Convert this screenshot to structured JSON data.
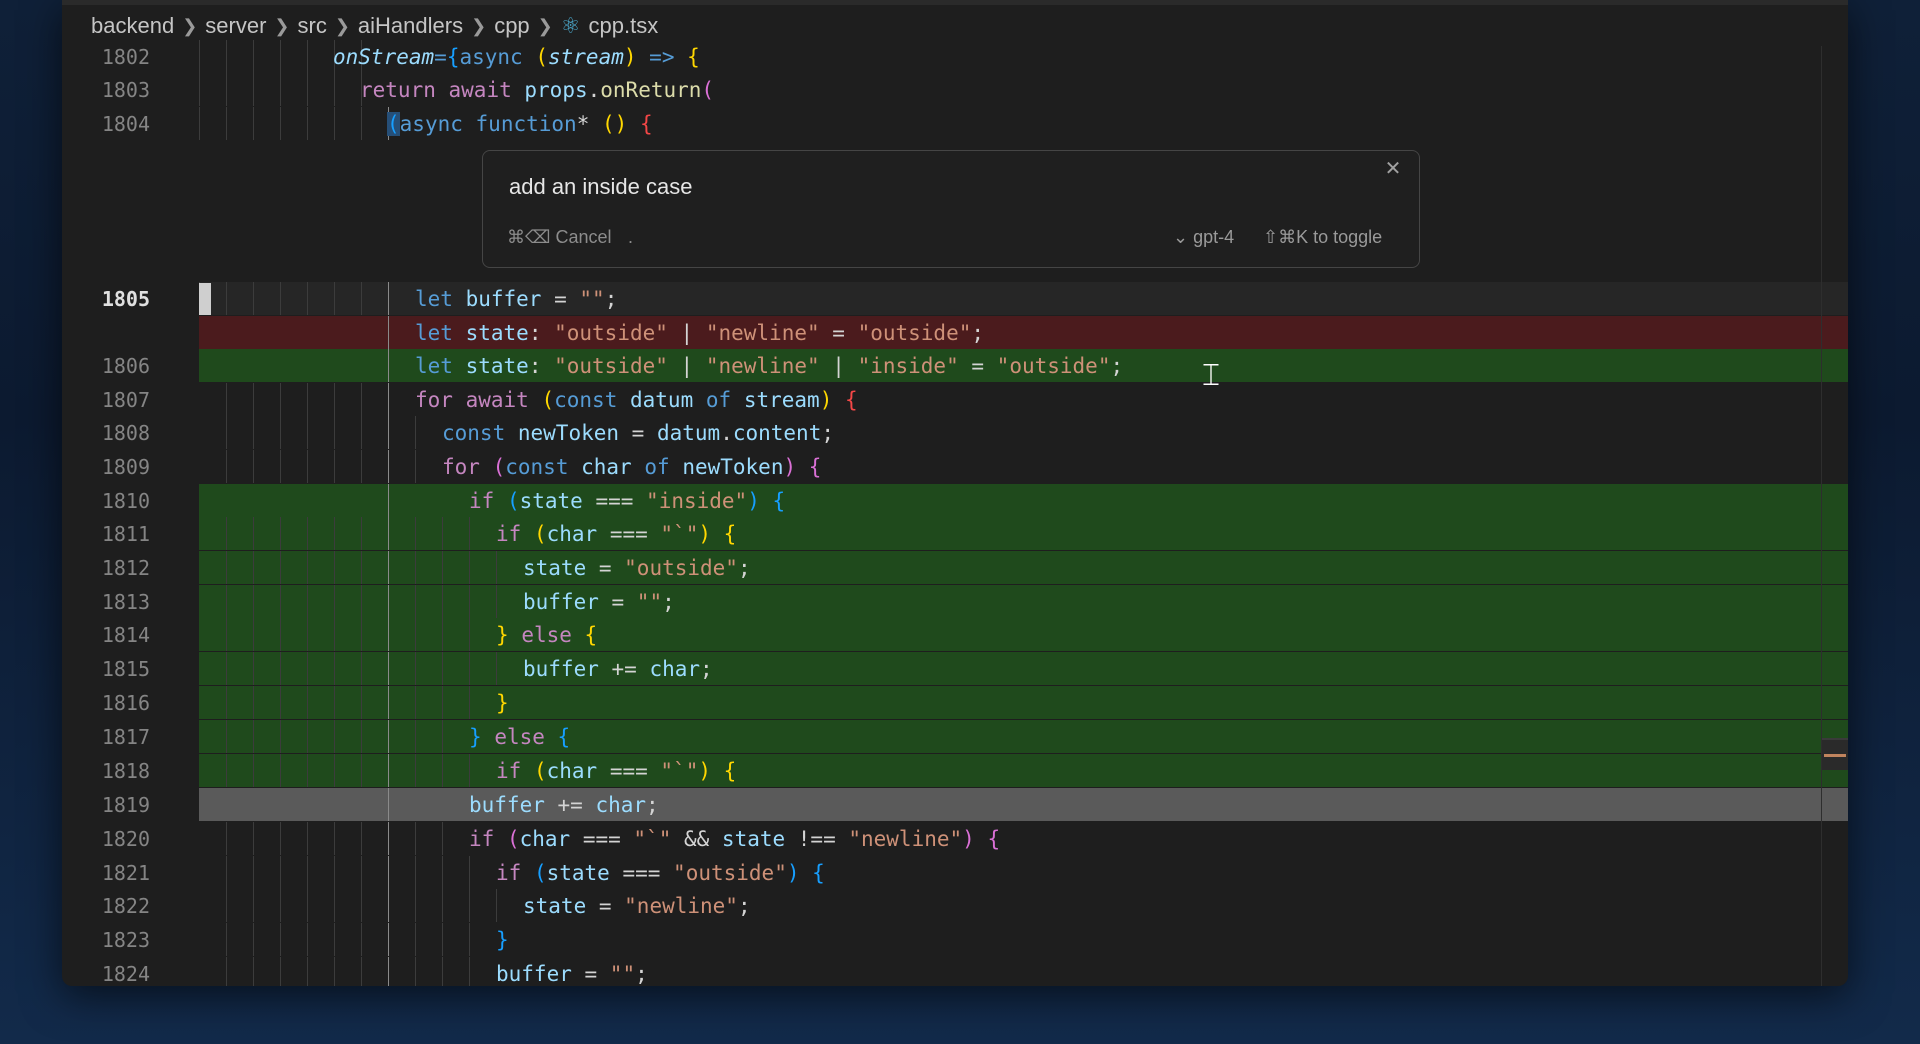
{
  "breadcrumb": [
    "backend",
    "server",
    "src",
    "aiHandlers",
    "cpp"
  ],
  "file": {
    "name": "cpp.tsx",
    "icon": "react-icon"
  },
  "prompt": {
    "value": "add an inside case",
    "cancel": "⌘⌫ Cancel",
    "dot": ".",
    "model": "⌄ gpt-4",
    "toggle": "⇧⌘K to toggle"
  },
  "code": [
    {
      "n": "1802",
      "t": "onStream={async (stream) => {"
    },
    {
      "n": "1803",
      "t": "return await props.onReturn("
    },
    {
      "n": "1804",
      "t": "(async function* () {"
    },
    {
      "n": "1805",
      "t": "let buffer = \"\";"
    },
    {
      "n": "",
      "t": "let state: \"outside\" | \"newline\" = \"outside\";"
    },
    {
      "n": "1806",
      "t": "let state: \"outside\" | \"newline\" | \"inside\" = \"outside\";"
    },
    {
      "n": "1807",
      "t": "for await (const datum of stream) {"
    },
    {
      "n": "1808",
      "t": "const newToken = datum.content;"
    },
    {
      "n": "1809",
      "t": "for (const char of newToken) {"
    },
    {
      "n": "1810",
      "t": "if (state === \"inside\") {"
    },
    {
      "n": "1811",
      "t": "if (char === \"`\") {"
    },
    {
      "n": "1812",
      "t": "state = \"outside\";"
    },
    {
      "n": "1813",
      "t": "buffer = \"\";"
    },
    {
      "n": "1814",
      "t": "} else {"
    },
    {
      "n": "1815",
      "t": "buffer += char;"
    },
    {
      "n": "1816",
      "t": "}"
    },
    {
      "n": "1817",
      "t": "} else {"
    },
    {
      "n": "1818",
      "t": "if (char === \"`\") {"
    },
    {
      "n": "1819",
      "t": "buffer += char;"
    },
    {
      "n": "1820",
      "t": "if (char === \"`\" && state !== \"newline\") {"
    },
    {
      "n": "1821",
      "t": "if (state === \"outside\") {"
    },
    {
      "n": "1822",
      "t": "state = \"newline\";"
    },
    {
      "n": "1823",
      "t": "}"
    },
    {
      "n": "1824",
      "t": "buffer = \"\";"
    }
  ]
}
